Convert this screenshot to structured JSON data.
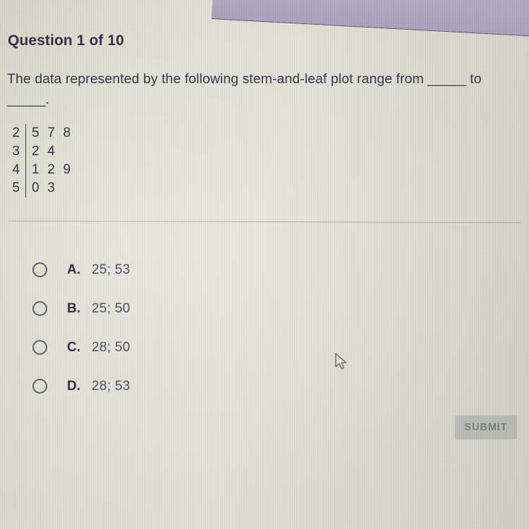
{
  "page": {
    "background_color": "#dcdbce",
    "accent_band_color": "#aea5c0"
  },
  "header": {
    "question_title": "Question 1 of 10"
  },
  "question": {
    "text": "The data represented by the following stem-and-leaf plot range from _____ to _____."
  },
  "stem_and_leaf": {
    "rows": [
      {
        "stem": "2",
        "leaves": "5 7 8"
      },
      {
        "stem": "3",
        "leaves": "2 4"
      },
      {
        "stem": "4",
        "leaves": "1 2 9"
      },
      {
        "stem": "5",
        "leaves": "0 3"
      }
    ]
  },
  "options": [
    {
      "letter": "A.",
      "value": "25; 53"
    },
    {
      "letter": "B.",
      "value": "25; 50"
    },
    {
      "letter": "C.",
      "value": "28; 50"
    },
    {
      "letter": "D.",
      "value": "28; 53"
    }
  ],
  "footer": {
    "submit_label": "SUBMIT"
  },
  "cursor": {
    "icon": "mouse-pointer-icon"
  }
}
